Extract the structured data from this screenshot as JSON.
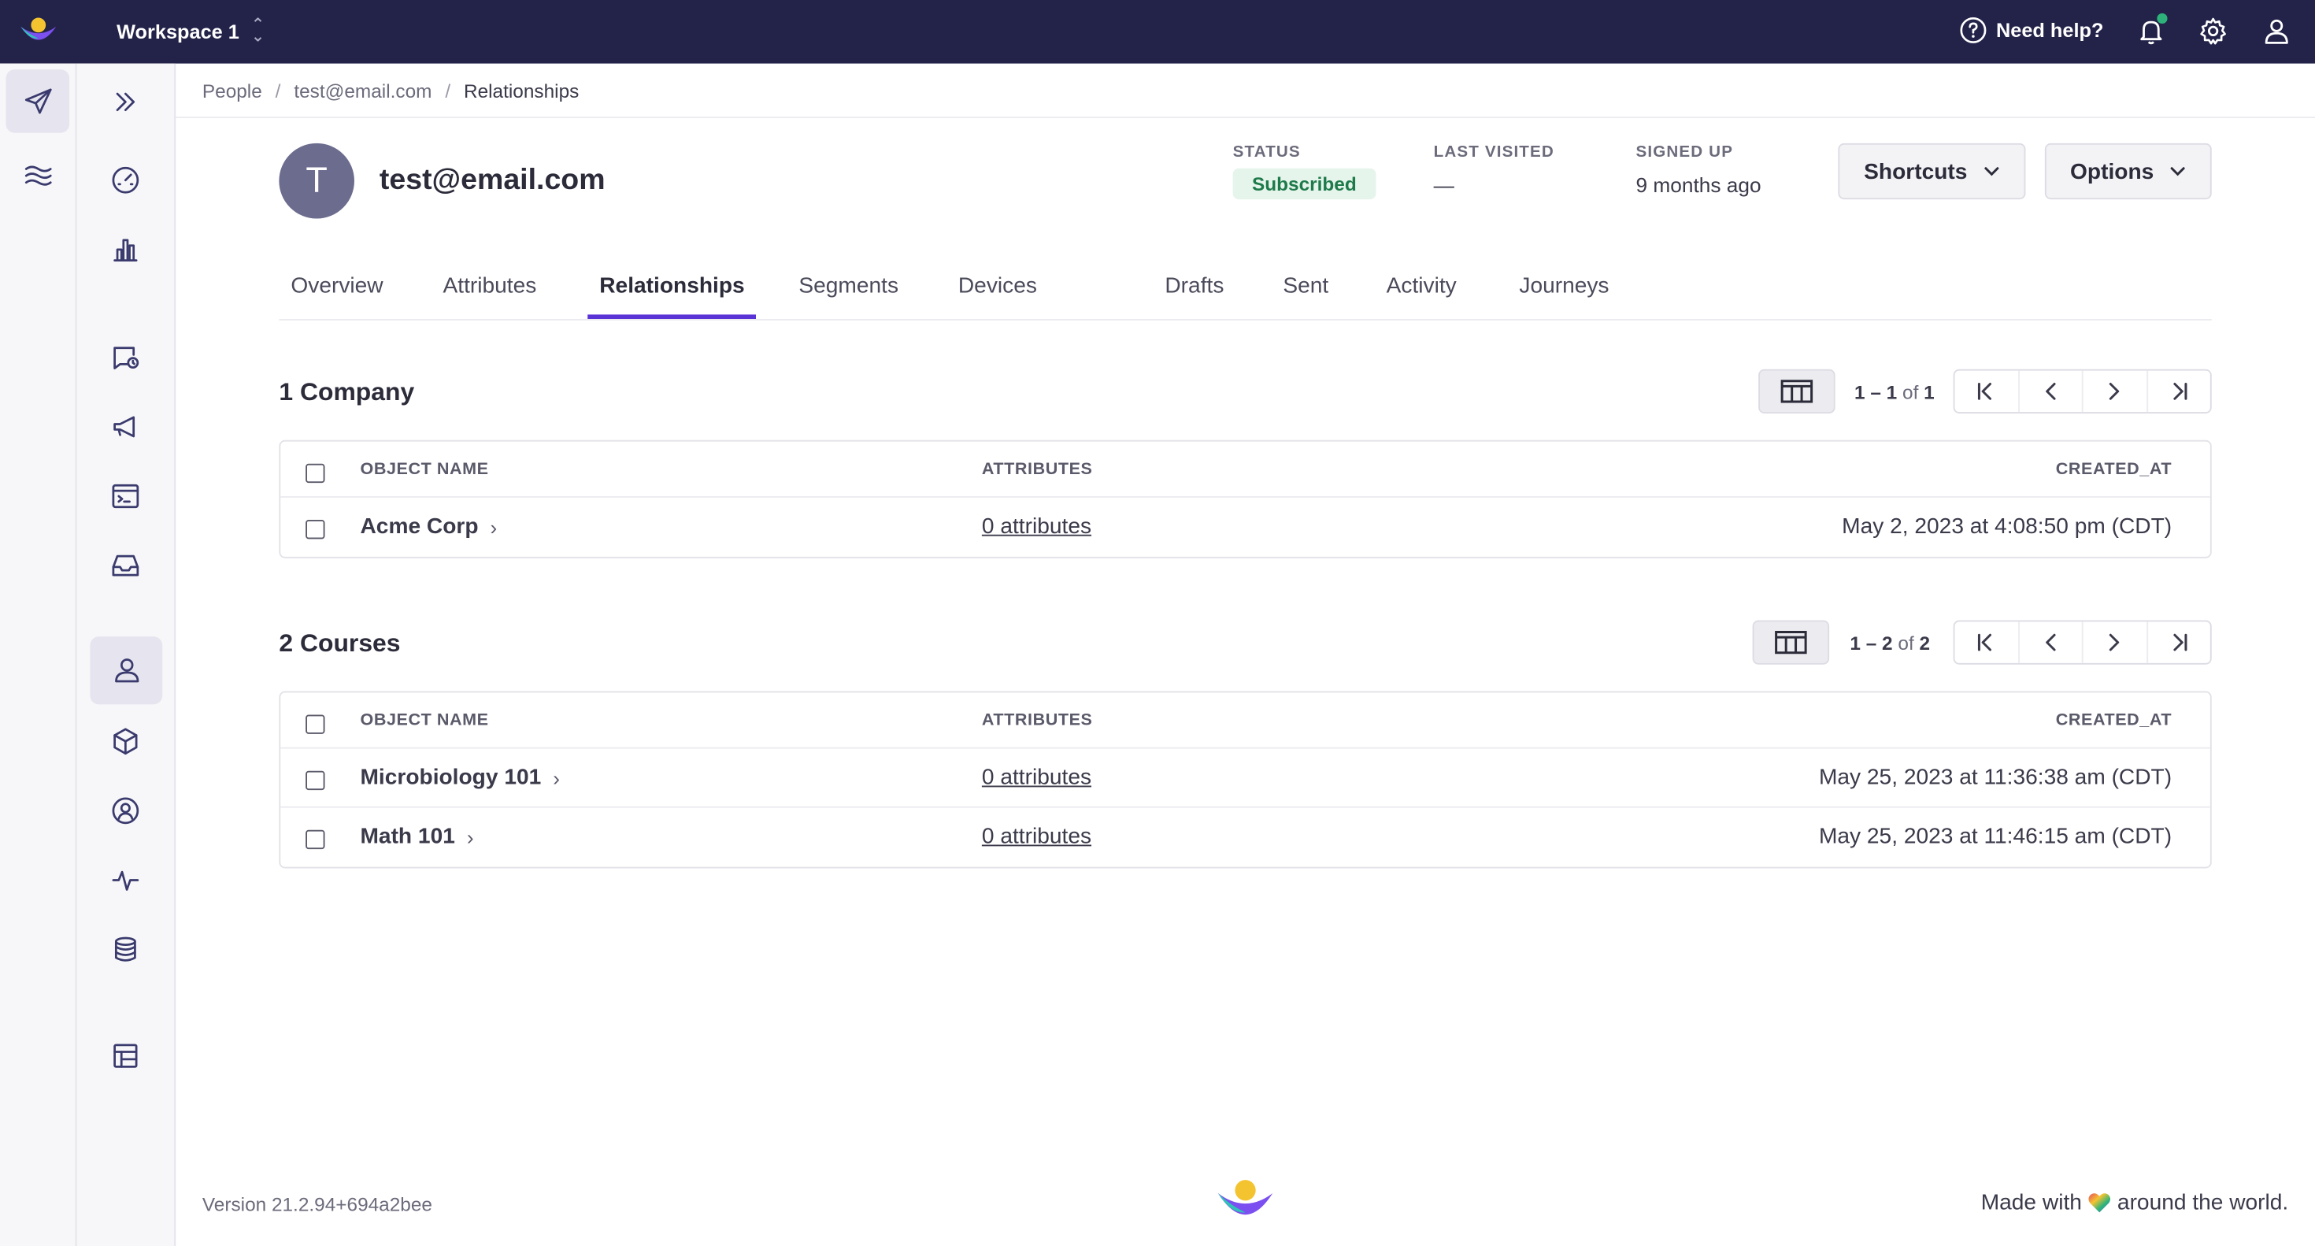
{
  "topbar": {
    "workspace": "Workspace 1",
    "help_label": "Need help?"
  },
  "breadcrumb": [
    "People",
    "test@email.com",
    "Relationships"
  ],
  "profile": {
    "avatar_letter": "T",
    "email": "test@email.com",
    "status_label": "STATUS",
    "status_value": "Subscribed",
    "last_visited_label": "LAST VISITED",
    "last_visited_value": "—",
    "signed_up_label": "SIGNED UP",
    "signed_up_value": "9 months ago",
    "shortcuts_label": "Shortcuts",
    "options_label": "Options"
  },
  "tabs": [
    "Overview",
    "Attributes",
    "Relationships",
    "Segments",
    "Devices",
    "Drafts",
    "Sent",
    "Activity",
    "Journeys"
  ],
  "active_tab": "Relationships",
  "columns": {
    "name": "OBJECT NAME",
    "attributes": "ATTRIBUTES",
    "created": "CREATED_AT"
  },
  "companies": {
    "title": "1 Company",
    "range": "1 – 1",
    "of_label": "of",
    "total": "1",
    "rows": [
      {
        "name": "Acme Corp",
        "attributes": "0 attributes",
        "created_at": "May 2, 2023 at 4:08:50 pm (CDT)"
      }
    ]
  },
  "courses": {
    "title": "2 Courses",
    "range": "1 – 2",
    "of_label": "of",
    "total": "2",
    "rows": [
      {
        "name": "Microbiology 101",
        "attributes": "0 attributes",
        "created_at": "May 25, 2023 at 11:36:38 am (CDT)"
      },
      {
        "name": "Math 101",
        "attributes": "0 attributes",
        "created_at": "May 25, 2023 at 11:46:15 am (CDT)"
      }
    ]
  },
  "footer": {
    "version": "Version 21.2.94+694a2bee",
    "made_prefix": "Made with",
    "made_suffix": "around the world."
  },
  "colors": {
    "topbar": "#23234a",
    "accent": "#5a33d6",
    "subscribed_bg": "#e6f5ec",
    "subscribed_text": "#1e7a4a"
  }
}
